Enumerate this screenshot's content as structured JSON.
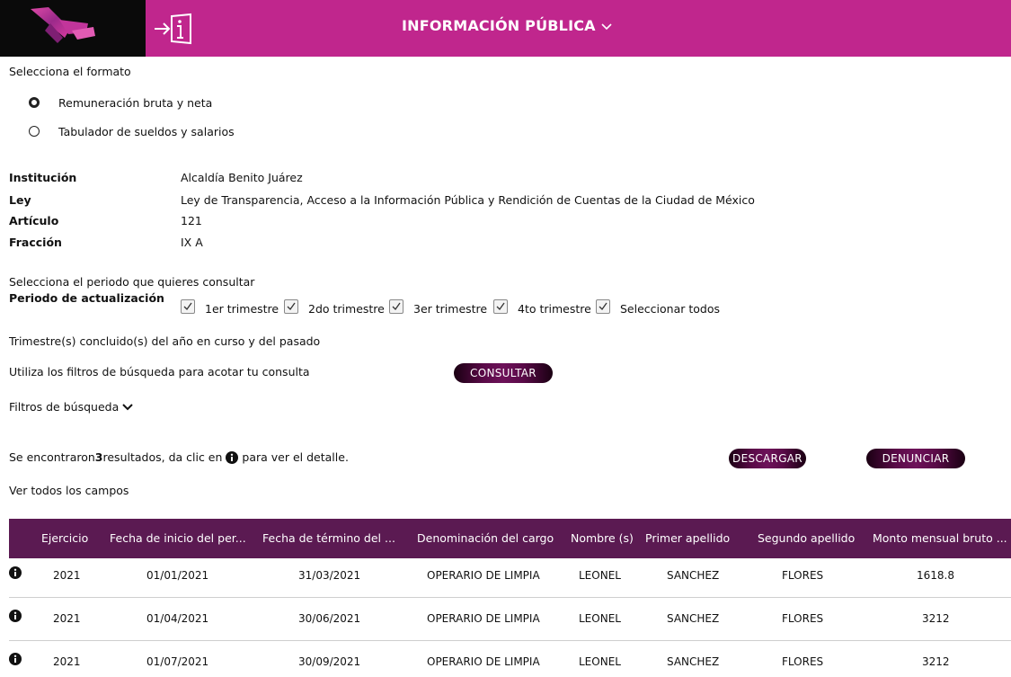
{
  "header": {
    "title": "INFORMACIÓN PÚBLICA",
    "colors": {
      "bar": "#c0268d",
      "logo_bg": "#0a0a0a"
    },
    "icons": {
      "exit": "enter-info-icon",
      "dropdown": "chevron-down-icon"
    }
  },
  "format": {
    "heading": "Selecciona el formato",
    "options": [
      {
        "label": "Remuneración bruta y neta",
        "selected": true
      },
      {
        "label": "Tabulador de sueldos y salarios",
        "selected": false
      }
    ]
  },
  "details": [
    {
      "key": "Institución",
      "value": "Alcaldía Benito Juárez"
    },
    {
      "key": "Ley",
      "value": "Ley de Transparencia, Acceso a la Información Pública y Rendición de Cuentas de la Ciudad de México"
    },
    {
      "key": "Artículo",
      "value": "121"
    },
    {
      "key": "Fracción",
      "value": "IX A"
    }
  ],
  "period": {
    "heading": "Selecciona el periodo que quieres consultar",
    "label": "Periodo de actualización",
    "options": [
      {
        "label": "1er trimestre",
        "checked": true
      },
      {
        "label": "2do trimestre",
        "checked": true
      },
      {
        "label": "3er trimestre",
        "checked": true
      },
      {
        "label": "4to trimestre",
        "checked": true
      },
      {
        "label": "Seleccionar todos",
        "checked": true
      }
    ],
    "note": "Trimestre(s) concluido(s) del año en curso y del pasado"
  },
  "search": {
    "hint": "Utiliza los filtros de búsqueda para acotar tu consulta",
    "consult_button": "CONSULTAR",
    "filters_toggle": "Filtros de búsqueda"
  },
  "results": {
    "prefix": "Se encontraron ",
    "count": "3",
    "middle": " resultados, da clic en ",
    "suffix": " para ver el detalle.",
    "download_button": "DESCARGAR",
    "report_button": "DENUNCIAR",
    "all_fields": "Ver todos los campos"
  },
  "table": {
    "header_color": "#5b1a52",
    "columns": [
      "Ejercicio",
      "Fecha de inicio del per...",
      "Fecha de término del ...",
      "Denominación del cargo",
      "Nombre (s)",
      "Primer apellido",
      "Segundo apellido",
      "Monto mensual bruto ..."
    ],
    "rows": [
      [
        "2021",
        "01/01/2021",
        "31/03/2021",
        "OPERARIO DE LIMPIA",
        "LEONEL",
        "SANCHEZ",
        "FLORES",
        "1618.8"
      ],
      [
        "2021",
        "01/04/2021",
        "30/06/2021",
        "OPERARIO DE LIMPIA",
        "LEONEL",
        "SANCHEZ",
        "FLORES",
        "3212"
      ],
      [
        "2021",
        "01/07/2021",
        "30/09/2021",
        "OPERARIO DE LIMPIA",
        "LEONEL",
        "SANCHEZ",
        "FLORES",
        "3212"
      ]
    ]
  }
}
